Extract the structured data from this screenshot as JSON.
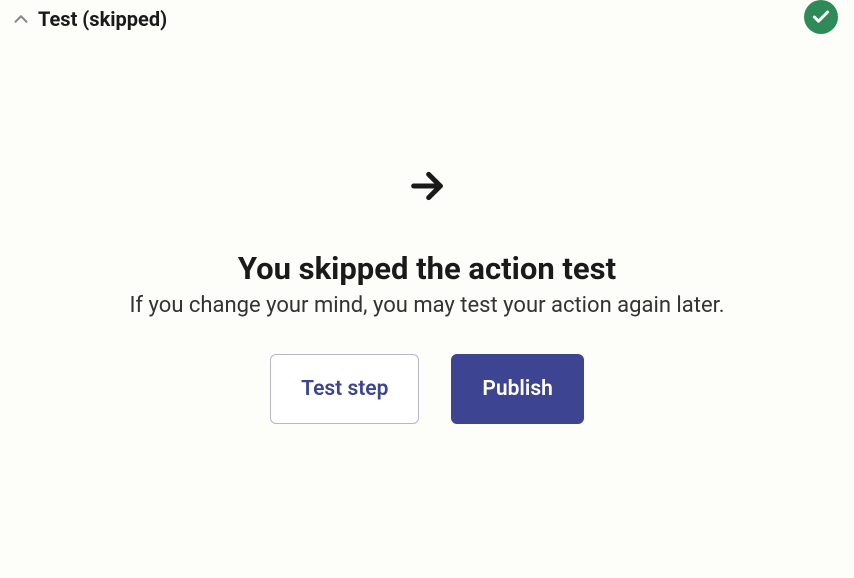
{
  "header": {
    "title": "Test (skipped)"
  },
  "main": {
    "title": "You skipped the action test",
    "subtitle": "If you change your mind, you may test your action again later.",
    "buttons": {
      "test_step": "Test step",
      "publish": "Publish"
    }
  }
}
